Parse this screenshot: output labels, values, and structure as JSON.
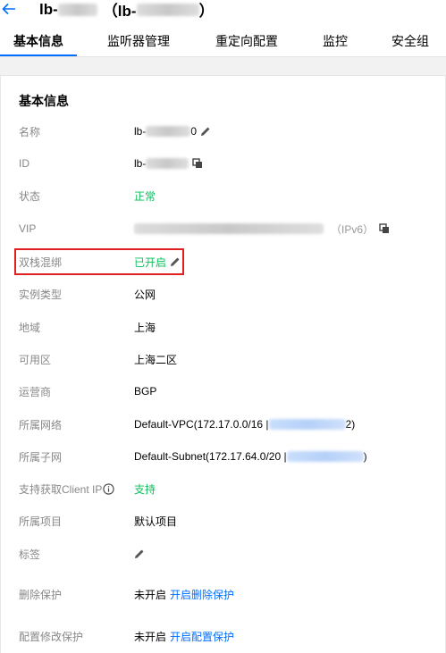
{
  "header": {
    "title_prefix": "lb-",
    "title_middle": "（lb-",
    "title_suffix": "）"
  },
  "tabs": [
    {
      "label": "基本信息"
    },
    {
      "label": "监听器管理"
    },
    {
      "label": "重定向配置"
    },
    {
      "label": "监控"
    },
    {
      "label": "安全组"
    }
  ],
  "section": {
    "title": "基本信息"
  },
  "rows": {
    "name": {
      "label": "名称",
      "value_prefix": "lb-",
      "value_suffix": "0"
    },
    "id": {
      "label": "ID",
      "value_prefix": "lb-"
    },
    "status": {
      "label": "状态",
      "value": "正常"
    },
    "vip": {
      "label": "VIP",
      "ipv6": "（IPv6）"
    },
    "dualstack": {
      "label": "双栈混绑",
      "value": "已开启"
    },
    "type": {
      "label": "实例类型",
      "value": "公网"
    },
    "region": {
      "label": "地域",
      "value": "上海"
    },
    "zone": {
      "label": "可用区",
      "value": "上海二区"
    },
    "isp": {
      "label": "运营商",
      "value": "BGP"
    },
    "vpc": {
      "label": "所属网络",
      "value_prefix": "Default-VPC(172.17.0.0/16 | ",
      "value_suffix": "2)"
    },
    "subnet": {
      "label": "所属子网",
      "value_prefix": "Default-Subnet(172.17.64.0/20 | ",
      "value_suffix": ")"
    },
    "clientip": {
      "label": "支持获取Client IP",
      "value": "支持"
    },
    "project": {
      "label": "所属项目",
      "value": "默认项目"
    },
    "tags": {
      "label": "标签"
    },
    "delete": {
      "label": "删除保护",
      "value": "未开启",
      "action": "开启删除保护"
    },
    "config": {
      "label": "配置修改保护",
      "value": "未开启",
      "action": "开启配置保护"
    }
  },
  "colors": {
    "accent": "#006eff",
    "success": "#0abf5b",
    "highlight": "#e02020"
  }
}
